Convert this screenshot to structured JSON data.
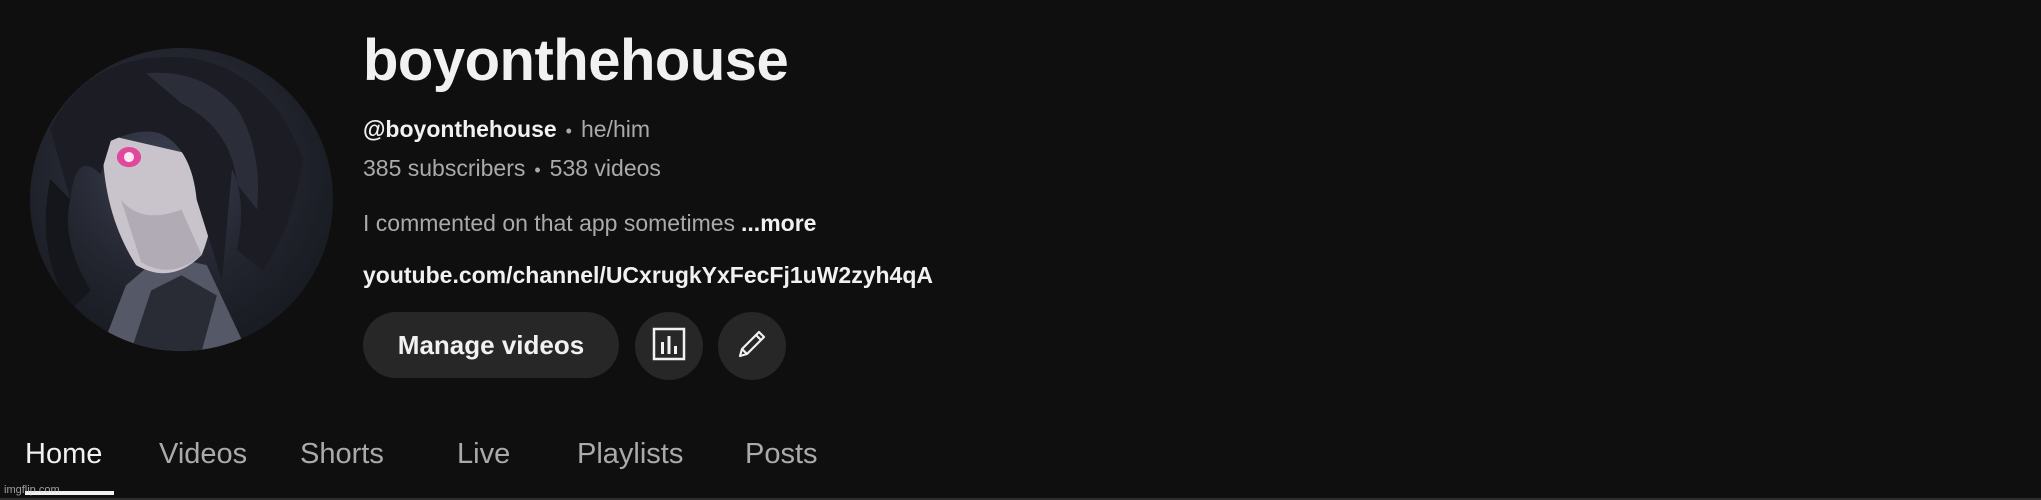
{
  "channel": {
    "name": "boyonthehouse",
    "handle": "@boyonthehouse",
    "pronouns": "he/him",
    "separator": "•",
    "subscribers": "385 subscribers",
    "videos": "538 videos",
    "description": "I commented on that app sometimes",
    "more_label": "...more",
    "link": "youtube.com/channel/UCxrugkYxFecFj1uW2zyh4qA"
  },
  "actions": {
    "manage_label": "Manage videos",
    "analytics_icon": "bar-chart-icon",
    "edit_icon": "pencil-icon"
  },
  "tabs": [
    {
      "label": "Home",
      "active": true
    },
    {
      "label": "Videos",
      "active": false
    },
    {
      "label": "Shorts",
      "active": false
    },
    {
      "label": "Live",
      "active": false
    },
    {
      "label": "Playlists",
      "active": false
    },
    {
      "label": "Posts",
      "active": false
    }
  ],
  "watermark": "imgflip.com",
  "colors": {
    "background": "#0f0f0f",
    "button_bg": "#272727",
    "text_primary": "#f1f1f1",
    "text_secondary": "#aaaaaa",
    "avatar_eye": "#e0489c"
  }
}
